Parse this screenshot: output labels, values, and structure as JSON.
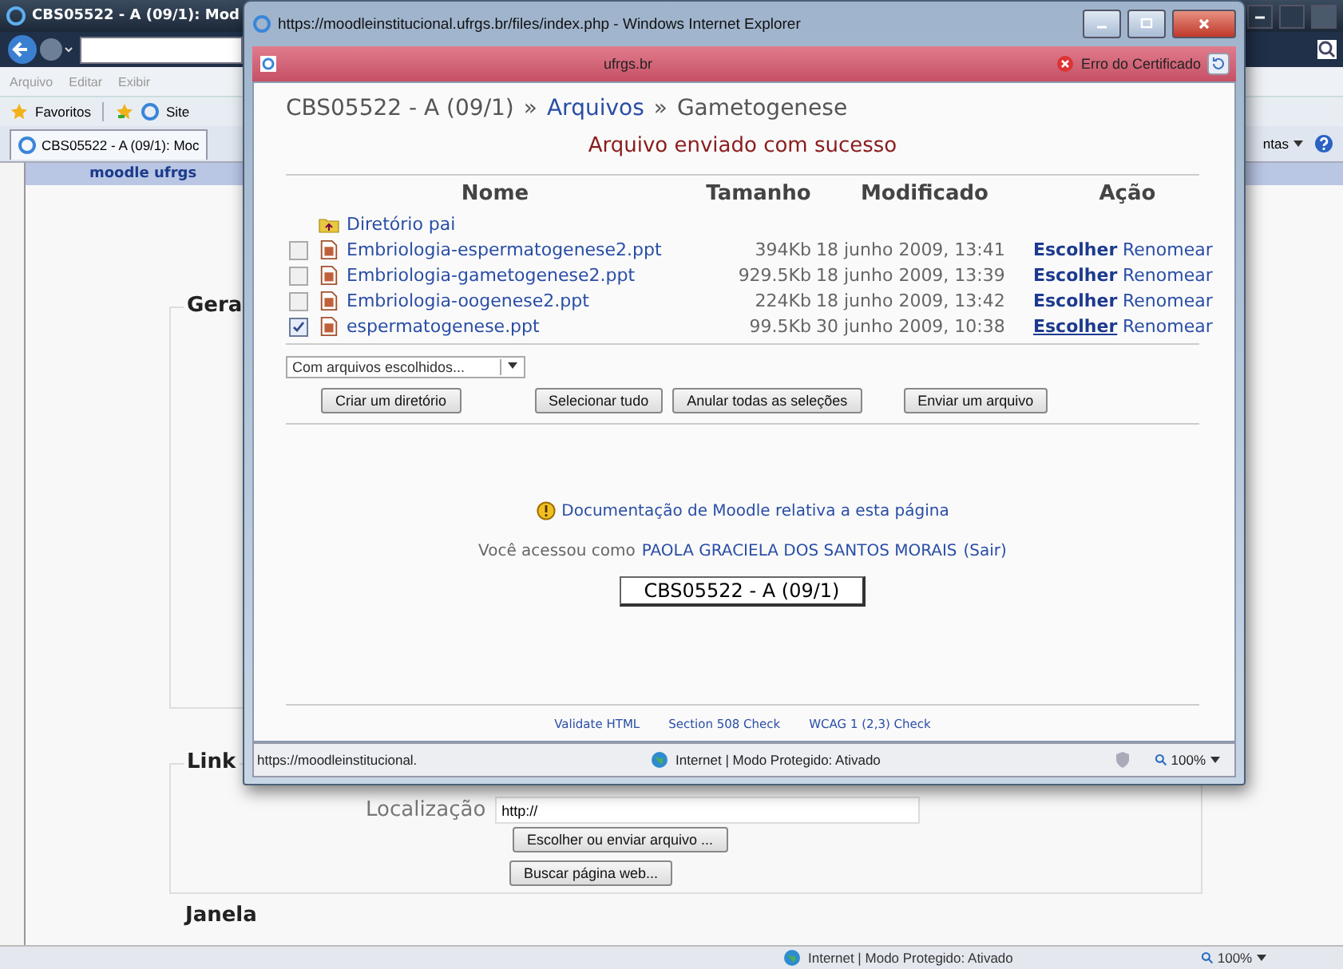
{
  "browser": {
    "title": "CBS05522 - A (09/1): Mod",
    "menu": [
      "Arquivo",
      "Editar",
      "Exibir"
    ],
    "favorites": [
      "Favoritos",
      "Site"
    ],
    "tab": "CBS05522 - A (09/1): Moc",
    "tools_menu": "ntas",
    "status": "Internet | Modo Protegido: Ativado",
    "zoom": "100%"
  },
  "page": {
    "header": "moodle ufrgs",
    "general_legend": "Gera",
    "link_legend": "Link",
    "location_label": "Localização",
    "location_value": "http://",
    "buttons": [
      "Escolher ou enviar arquivo ...",
      "Buscar página web..."
    ],
    "next_legend": "Janela"
  },
  "popup": {
    "title": "https://moodleinstitucional.ufrgs.br/files/index.php - Windows Internet Explorer",
    "address": "ufrgs.br",
    "certificate": "Erro do Certificado",
    "separator": "»",
    "breadcrumb": [
      {
        "text": "CBS05522 - A (09/1)",
        "link": false
      },
      {
        "text": "Arquivos",
        "link": true
      },
      {
        "text": "Gametogenese",
        "link": false
      }
    ],
    "message": "Arquivo enviado com sucesso",
    "columns": [
      "Nome",
      "Tamanho",
      "Modificado",
      "Ação"
    ],
    "parent": "Diretório pai",
    "files": [
      {
        "name": "Embriologia-espermatogenese2.ppt",
        "size": "394Kb",
        "modified": "18 junho 2009, 13:41",
        "choose": "Escolher",
        "rename": "Renomear",
        "checked": false
      },
      {
        "name": "Embriologia-gametogenese2.ppt",
        "size": "929.5Kb",
        "modified": "18 junho 2009, 13:39",
        "choose": "Escolher",
        "rename": "Renomear",
        "checked": false
      },
      {
        "name": "Embriologia-oogenese2.ppt",
        "size": "224Kb",
        "modified": "18 junho 2009, 13:42",
        "choose": "Escolher",
        "rename": "Renomear",
        "checked": false
      },
      {
        "name": "espermatogenese.ppt",
        "size": "99.5Kb",
        "modified": "30 junho 2009, 10:38",
        "choose": "Escolher",
        "rename": "Renomear",
        "checked": true
      }
    ],
    "with_selected": "Com arquivos escolhidos...",
    "buttons": [
      "Criar um diretório",
      "Selecionar tudo",
      "Anular todas as seleções",
      "Enviar um arquivo"
    ],
    "doc_link": "Documentação de Moodle relativa a esta página",
    "login_prefix": "Você acessou como",
    "user": "PAOLA GRACIELA DOS SANTOS MORAIS",
    "logout": "(Sair)",
    "course_button": "CBS05522 - A (09/1)",
    "footer_links": [
      "Validate HTML",
      "Section 508 Check",
      "WCAG 1 (2,3) Check"
    ],
    "status_url": "https://moodleinstitucional.",
    "status": "Internet | Modo Protegido: Ativado",
    "zoom": "100%"
  }
}
